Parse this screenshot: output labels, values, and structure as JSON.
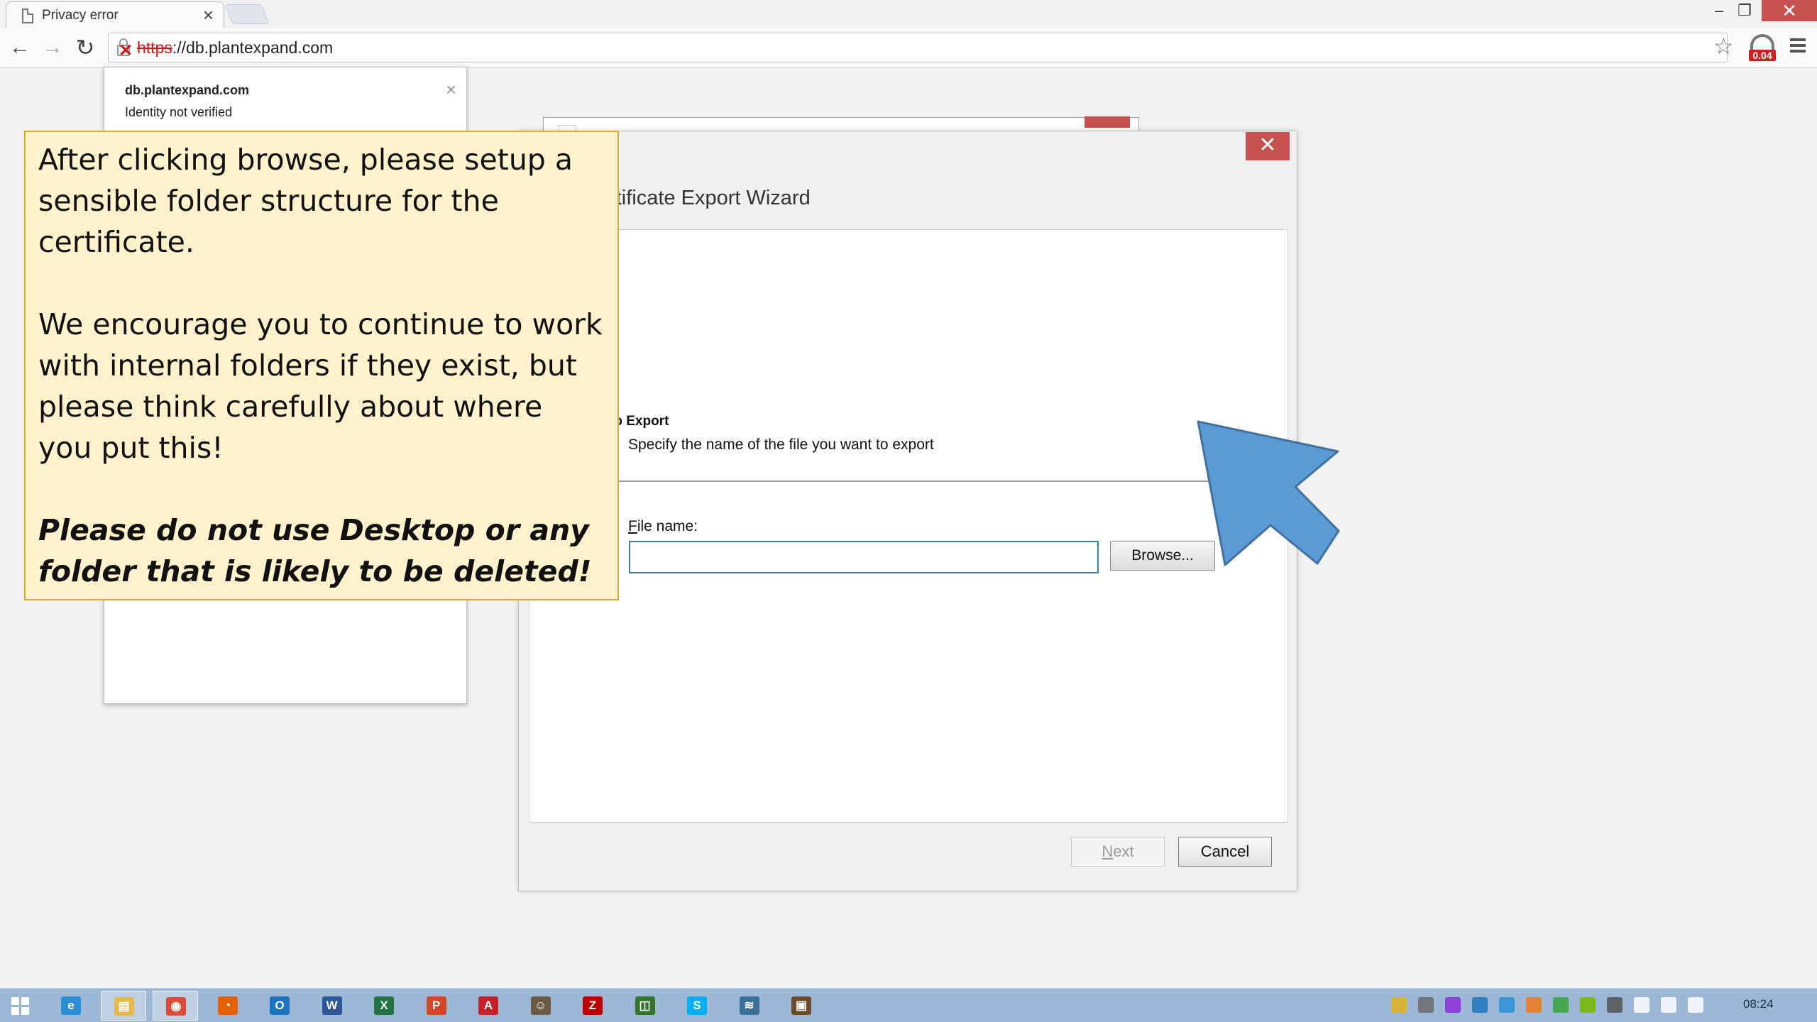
{
  "browser": {
    "tab_title": "Privacy error",
    "tab_close": "×",
    "url_scheme": "https",
    "url_rest": "://db.plantexpand.com",
    "extension_badge": "0.04",
    "win_min": "–",
    "win_max": "❐",
    "win_close": "✕"
  },
  "site_popup": {
    "host": "db.plantexpand.com",
    "identity": "Identity not verified",
    "close": "×"
  },
  "wizard": {
    "close": "✕",
    "title": "Certificate Export Wizard",
    "heading": "File to Export",
    "subheading": "Specify the name of the file you want to export",
    "file_label_accel": "F",
    "file_label_rest": "ile name:",
    "file_value": "",
    "browse_label": "Browse...",
    "next_accel": "N",
    "next_rest": "ext",
    "cancel_label": "Cancel"
  },
  "callout": {
    "para1": "After clicking browse, please setup a sensible folder structure for the certificate.",
    "para2": "We encourage you to continue to work with internal folders if they exist, but please think carefully about where you put this!",
    "warning": "Please do not use Desktop or any folder that is likely to be deleted!"
  },
  "taskbar": {
    "clock": "08:24",
    "apps": [
      {
        "name": "internet-explorer",
        "glyph": "e",
        "color": "#2a8fd6"
      },
      {
        "name": "file-explorer",
        "glyph": "▤",
        "color": "#e7b84a",
        "active": true
      },
      {
        "name": "chrome",
        "glyph": "◉",
        "color": "#dd4b39",
        "active": true
      },
      {
        "name": "firefox",
        "glyph": "◔",
        "color": "#e66000"
      },
      {
        "name": "outlook",
        "glyph": "O",
        "color": "#1e73be"
      },
      {
        "name": "word",
        "glyph": "W",
        "color": "#2b579a"
      },
      {
        "name": "excel",
        "glyph": "X",
        "color": "#217346"
      },
      {
        "name": "powerpoint",
        "glyph": "P",
        "color": "#d24726"
      },
      {
        "name": "acrobat",
        "glyph": "A",
        "color": "#c8202a"
      },
      {
        "name": "gimp",
        "glyph": "☺",
        "color": "#6b5a44"
      },
      {
        "name": "filezilla",
        "glyph": "Z",
        "color": "#bf0000"
      },
      {
        "name": "project",
        "glyph": "◫",
        "color": "#31752f"
      },
      {
        "name": "skype",
        "glyph": "S",
        "color": "#00aff0"
      },
      {
        "name": "python",
        "glyph": "≋",
        "color": "#3b6e9b"
      },
      {
        "name": "certmgr",
        "glyph": "▣",
        "color": "#6b4b2a"
      }
    ],
    "tray": [
      {
        "name": "tray-arrow-icon",
        "color": "#e3b21c"
      },
      {
        "name": "tray-people-icon",
        "color": "#6a6a6a"
      },
      {
        "name": "tray-onenote-icon",
        "color": "#8a2bd8"
      },
      {
        "name": "tray-outlook-icon",
        "color": "#1e73be"
      },
      {
        "name": "tray-network-icon",
        "color": "#2a8fd6"
      },
      {
        "name": "tray-warning-icon",
        "color": "#f07818"
      },
      {
        "name": "tray-check-icon",
        "color": "#3aa53a"
      },
      {
        "name": "tray-nvidia-icon",
        "color": "#76b900"
      },
      {
        "name": "tray-flag-icon",
        "color": "#555555"
      },
      {
        "name": "tray-battery-icon",
        "color": "#ffffff"
      },
      {
        "name": "tray-signal-icon",
        "color": "#ffffff"
      },
      {
        "name": "tray-volume-icon",
        "color": "#ffffff"
      }
    ]
  }
}
